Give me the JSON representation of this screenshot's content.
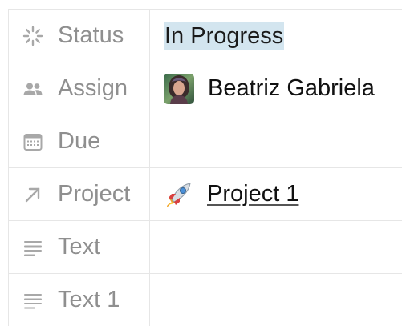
{
  "properties": [
    {
      "icon": "status-spinner-icon",
      "label": "Status",
      "value": "In Progress"
    },
    {
      "icon": "people-icon",
      "label": "Assign",
      "value": "Beatriz Gabriela"
    },
    {
      "icon": "calendar-icon",
      "label": "Due",
      "value": ""
    },
    {
      "icon": "arrow-up-right-icon",
      "label": "Project",
      "value": "Project 1",
      "value_icon": "rocket-icon"
    },
    {
      "icon": "text-lines-icon",
      "label": "Text",
      "value": ""
    },
    {
      "icon": "text-lines-icon",
      "label": "Text 1",
      "value": ""
    }
  ],
  "colors": {
    "status_highlight": "#d3e5ef",
    "label_text": "#8f8f8f",
    "border": "#e6e6e6"
  }
}
